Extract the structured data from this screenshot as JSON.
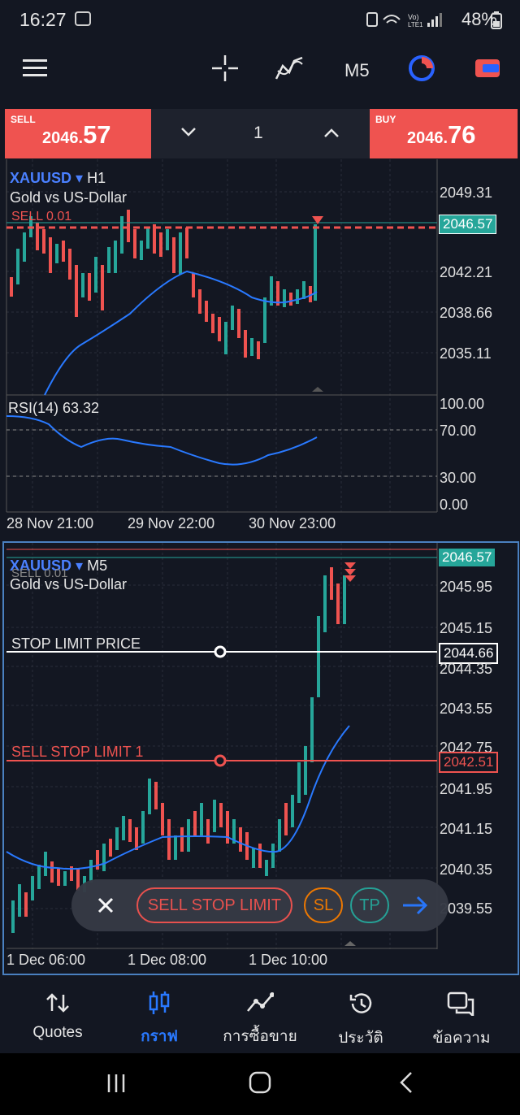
{
  "status_bar": {
    "time": "16:27",
    "battery": "48%",
    "network": "Vo) LTE1"
  },
  "toolbar": {
    "timeframe": "M5",
    "icons": [
      "menu-icon",
      "crosshair-icon",
      "indicators-icon",
      "timeframe-label",
      "clock-icon",
      "orders-icon"
    ]
  },
  "trade_panel": {
    "sell_label": "SELL",
    "sell_price_main": "2046.",
    "sell_price_big": "57",
    "buy_label": "BUY",
    "buy_price_main": "2046.",
    "buy_price_big": "76",
    "lot": "1"
  },
  "chart_top": {
    "symbol": "XAUUSD",
    "timeframe": "H1",
    "description": "Gold vs US-Dollar",
    "position_label": "SELL 0.01",
    "price_axis": [
      "2049.31",
      "2042.21",
      "2038.66",
      "2035.11"
    ],
    "current_price": "2046.57",
    "rsi_label": "RSI(14) 63.32",
    "rsi_axis": [
      "100.00",
      "70.00",
      "30.00",
      "0.00"
    ],
    "time_axis": [
      "28 Nov 21:00",
      "29 Nov 22:00",
      "30 Nov 23:00"
    ]
  },
  "chart_bottom": {
    "symbol": "XAUUSD",
    "timeframe": "M5",
    "description": "Gold vs US-Dollar",
    "position_label": "SELL 0.01",
    "stop_limit_label": "STOP LIMIT PRICE",
    "stop_limit_price": "2044.66",
    "sell_stop_limit_label": "SELL STOP LIMIT 1",
    "sell_stop_limit_price": "2042.51",
    "current_price": "2046.57",
    "price_axis": [
      "2045.95",
      "2045.15",
      "2044.35",
      "2043.55",
      "2042.75",
      "2041.95",
      "2041.15",
      "2040.35",
      "2039.55"
    ],
    "time_axis": [
      "1 Dec 06:00",
      "1 Dec 08:00",
      "1 Dec 10:00"
    ]
  },
  "order_bar": {
    "order_type": "SELL STOP LIMIT",
    "sl": "SL",
    "tp": "TP"
  },
  "nav": [
    {
      "label": "Quotes",
      "icon": "quotes-icon"
    },
    {
      "label": "กราฟ",
      "icon": "chart-icon"
    },
    {
      "label": "การซื้อขาย",
      "icon": "trade-icon"
    },
    {
      "label": "ประวัติ",
      "icon": "history-icon"
    },
    {
      "label": "ข้อความ",
      "icon": "messages-icon"
    }
  ],
  "colors": {
    "bg": "#131722",
    "bull": "#26a69a",
    "bear": "#ef5350",
    "accent": "#2962ff",
    "ma": "#2979ff"
  }
}
